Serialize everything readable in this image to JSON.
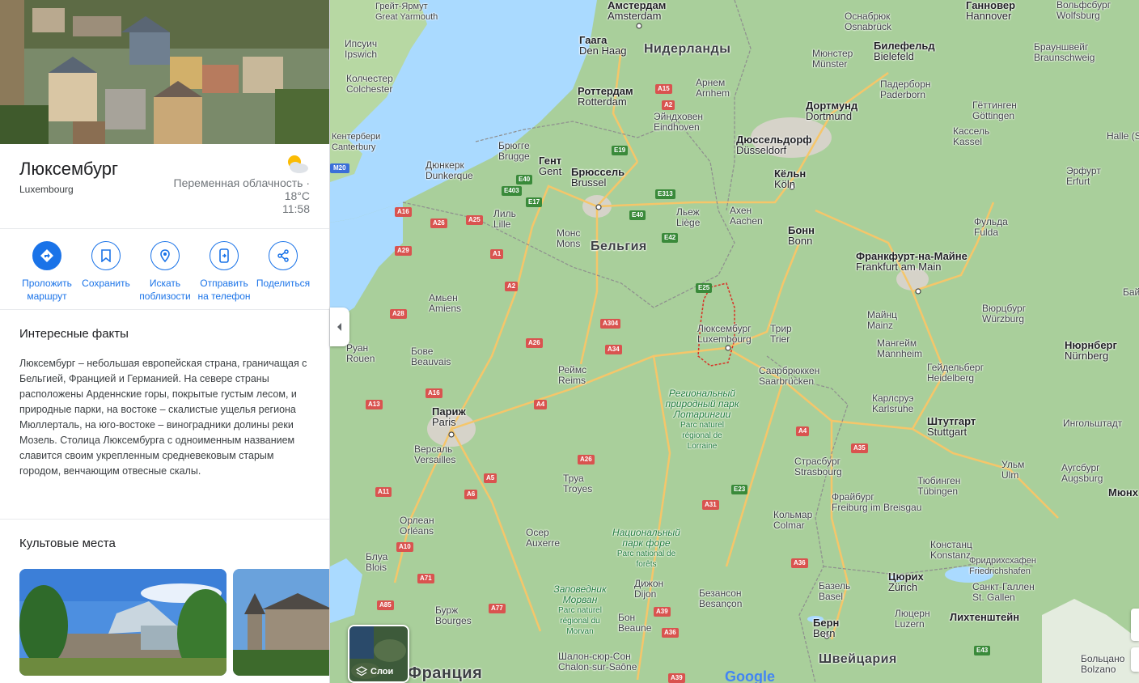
{
  "place": {
    "title": "Люксембург",
    "subtitle": "Luxembourg",
    "weather": {
      "description": "Переменная облачность ·",
      "temperature": "18°C",
      "time": "11:58",
      "icon": "partly-cloudy-icon"
    }
  },
  "actions": [
    {
      "label1": "Проложить",
      "label2": "маршрут",
      "icon": "directions-icon"
    },
    {
      "label1": "Сохранить",
      "label2": "",
      "icon": "bookmark-icon"
    },
    {
      "label1": "Искать",
      "label2": "поблизости",
      "icon": "nearby-icon"
    },
    {
      "label1": "Отправить",
      "label2": "на телефон",
      "icon": "send-to-phone-icon"
    },
    {
      "label1": "Поделиться",
      "label2": "",
      "icon": "share-icon"
    }
  ],
  "facts": {
    "title": "Интересные факты",
    "text": "Люксембург – небольшая европейская страна, граничащая с Бельгией, Францией и Германией. На севере страны расположены Арденнские горы, покрытые густым лесом, и природные парки, на востоке – скалистые ущелья региона Мюллерталь, на юго-востоке – виноградники долины реки Мозель. Столица Люксембурга с одноименным названием славится своим укрепленным средневековым старым городом, венчающим отвесные скалы."
  },
  "landmarks": {
    "title": "Культовые места"
  },
  "map": {
    "layers_label": "Слои",
    "google": "Google",
    "countries": [
      {
        "text": "Нидерланды"
      },
      {
        "text": "Бельгия"
      },
      {
        "text": "Франция"
      },
      {
        "text": "Швейцария"
      },
      {
        "text": "Лихтенштейн"
      }
    ],
    "cities": [
      {
        "ru": "Амстердам",
        "en": "Amsterdam"
      },
      {
        "ru": "Гаага",
        "en": "Den Haag"
      },
      {
        "ru": "Роттердам",
        "en": "Rotterdam"
      },
      {
        "ru": "Эйндховен",
        "en": "Eindhoven"
      },
      {
        "ru": "Арнем",
        "en": "Arnhem"
      },
      {
        "ru": "Брюгге",
        "en": "Brugge"
      },
      {
        "ru": "Гент",
        "en": "Gent"
      },
      {
        "ru": "Брюссель",
        "en": "Brussel"
      },
      {
        "ru": "Дюнкерк",
        "en": "Dunkerque"
      },
      {
        "ru": "Лиль",
        "en": "Lille"
      },
      {
        "ru": "Монс",
        "en": "Mons"
      },
      {
        "ru": "Льеж",
        "en": "Liège"
      },
      {
        "ru": "Ахен",
        "en": "Aachen"
      },
      {
        "ru": "Кёльн",
        "en": "Köln"
      },
      {
        "ru": "Бонн",
        "en": "Bonn"
      },
      {
        "ru": "Дюссельдорф",
        "en": "Düsseldorf"
      },
      {
        "ru": "Дортмунд",
        "en": "Dortmund"
      },
      {
        "ru": "Мюнстер",
        "en": "Münster"
      },
      {
        "ru": "Билефельд",
        "en": "Bielefeld"
      },
      {
        "ru": "Оснабрюк",
        "en": "Osnabrück"
      },
      {
        "ru": "Ганновер",
        "en": "Hannover"
      },
      {
        "ru": "Падерборн",
        "en": "Paderborn"
      },
      {
        "ru": "Кассель",
        "en": "Kassel"
      },
      {
        "ru": "Гёттинген",
        "en": "Göttingen"
      },
      {
        "ru": "Франкфурт-на-Майне",
        "en": "Frankfurt am Main"
      },
      {
        "ru": "Майнц",
        "en": "Mainz"
      },
      {
        "ru": "Мангейм",
        "en": "Mannheim"
      },
      {
        "ru": "Гейдельберг",
        "en": "Heidelberg"
      },
      {
        "ru": "Вюрцбург",
        "en": "Würzburg"
      },
      {
        "ru": "Нюрнберг",
        "en": "Nürnberg"
      },
      {
        "ru": "Карлсруэ",
        "en": "Karlsruhe"
      },
      {
        "ru": "Штутгарт",
        "en": "Stuttgart"
      },
      {
        "ru": "Люксембург",
        "en": "Luxembourg"
      },
      {
        "ru": "Трир",
        "en": "Trier"
      },
      {
        "ru": "Саарбрюккен",
        "en": "Saarbrücken"
      },
      {
        "ru": "Амьен",
        "en": "Amiens"
      },
      {
        "ru": "Руан",
        "en": "Rouen"
      },
      {
        "ru": "Бове",
        "en": "Beauvais"
      },
      {
        "ru": "Реймс",
        "en": "Reims"
      },
      {
        "ru": "Париж",
        "en": "Paris"
      },
      {
        "ru": "Версаль",
        "en": "Versailles"
      },
      {
        "ru": "Труа",
        "en": "Troyes"
      },
      {
        "ru": "Орлеан",
        "en": "Orléans"
      },
      {
        "ru": "Блуа",
        "en": "Blois"
      },
      {
        "ru": "Осер",
        "en": "Auxerre"
      },
      {
        "ru": "Бурж",
        "en": "Bourges"
      },
      {
        "ru": "Дижон",
        "en": "Dijon"
      },
      {
        "ru": "Бон",
        "en": "Beaune"
      },
      {
        "ru": "Безансон",
        "en": "Besançon"
      },
      {
        "ru": "Страсбург",
        "en": "Strasbourg"
      },
      {
        "ru": "Кольмар",
        "en": "Colmar"
      },
      {
        "ru": "Фрайбург",
        "en": "Freiburg im Breisgau"
      },
      {
        "ru": "Базель",
        "en": "Basel"
      },
      {
        "ru": "Цюрих",
        "en": "Zürich"
      },
      {
        "ru": "Берн",
        "en": "Bern"
      },
      {
        "ru": "Люцерн",
        "en": "Luzern"
      },
      {
        "ru": "Констанц",
        "en": "Konstanz"
      },
      {
        "ru": "Фридрихсхафен",
        "en": "Friedrichshafen"
      },
      {
        "ru": "Санкт-Галлен",
        "en": "St. Gallen"
      },
      {
        "ru": "Тюбинген",
        "en": "Tübingen"
      },
      {
        "ru": "Ульм",
        "en": "Ulm"
      },
      {
        "ru": "Аугсбург",
        "en": "Augsburg"
      },
      {
        "ru": "Ингольштадт",
        "en": ""
      },
      {
        "ru": "Эрфурт",
        "en": "Erfurt"
      },
      {
        "ru": "Фульда",
        "en": "Fulda"
      },
      {
        "ru": "Вольфсбург",
        "en": "Wolfsburg"
      },
      {
        "ru": "Брауншвейг",
        "en": "Braunschweig"
      },
      {
        "ru": "Шалон-сюр-Сон",
        "en": "Chalon-sur-Saône"
      },
      {
        "ru": "Ипсуич",
        "en": "Ipswich"
      },
      {
        "ru": "Колчестер",
        "en": "Colchester"
      },
      {
        "ru": "Кентербери",
        "en": "Canterbury"
      },
      {
        "ru": "Грейт-Ярмут",
        "en": "Great Yarmouth"
      },
      {
        "ru": "Больцано",
        "en": "Bolzano"
      },
      {
        "ru": "Галле",
        "en": "Halle (Saale)"
      },
      {
        "ru": "Байрой",
        "en": "Bayreuth"
      },
      {
        "ru": "Мюнх",
        "en": "Münch"
      }
    ],
    "parks": [
      {
        "ru": "Региональный природный парк Лотарингии",
        "fr": "Parc naturel régional de Lorraine"
      },
      {
        "ru": "Национальный парк форе",
        "fr": "Parc national de forêts"
      },
      {
        "ru": "Заповедник Морван",
        "fr": "Parc naturel régional du Morvan"
      }
    ],
    "roads": [
      "A16",
      "A26",
      "A25",
      "A1",
      "A2",
      "A28",
      "A29",
      "A304",
      "A34",
      "A26",
      "A4",
      "A13",
      "A16",
      "A11",
      "A10",
      "A71",
      "A85",
      "A77",
      "A6",
      "A5",
      "A26",
      "A31",
      "E23",
      "A4",
      "A35",
      "A36",
      "A39",
      "A36",
      "A39",
      "E25",
      "E40",
      "E42",
      "E17",
      "E403",
      "E313",
      "E19",
      "A15",
      "A2",
      "E43",
      "E40",
      "M20"
    ]
  }
}
